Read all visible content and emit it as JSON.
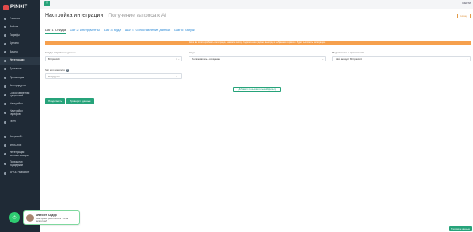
{
  "brand": {
    "logo_text": "PINKIT"
  },
  "sidebar": {
    "items": [
      {
        "label": "Главная"
      },
      {
        "label": "Войны"
      },
      {
        "label": "Тарифы"
      },
      {
        "label": "Купоны"
      },
      {
        "label": "Видео"
      },
      {
        "label": "Интеграции"
      },
      {
        "label": "Доставка"
      },
      {
        "label": "Промокоды"
      },
      {
        "label": "Акт.продукты"
      },
      {
        "label": "Сопоставления\nсущностей"
      },
      {
        "label": "Настройки"
      },
      {
        "label": "Настройки\nтарифов"
      },
      {
        "label": "Телл"
      }
    ],
    "bottom_items": [
      {
        "label": "Битрикс24"
      },
      {
        "label": "amoCRM"
      },
      {
        "label": "Интеграция\nавтоматизации"
      },
      {
        "label": "Помощник\nподдержки"
      },
      {
        "label": "API & Разработ"
      }
    ]
  },
  "topbar": {
    "add_label": "+",
    "user_label": "Выйти"
  },
  "page": {
    "title": "Настройка интеграции",
    "subtitle": "Получение запроса к AI",
    "back_label": "Назад"
  },
  "tabs": [
    {
      "label": "Шаг 1: Откуда"
    },
    {
      "label": "Шаг 2: Инструменты"
    },
    {
      "label": "Шаг 3: Куда"
    },
    {
      "label": "Шаг 4: Сопоставление данных"
    },
    {
      "label": "Шаг 5: Запуск"
    }
  ],
  "notice": "Если вы хотите добавить интеграцию, нажмите кнопку. Подключение сделает выборку в выбранном сервисе и будет выполнять интеграцию.",
  "form": {
    "source": {
      "label": "Откуда отправлены данные",
      "value": "Битрикс24"
    },
    "events": {
      "label": "Когда",
      "value": "Пользователь - создание"
    },
    "account": {
      "label": "Подключенные приложения",
      "value": "Мой аккаунт Битрикс24"
    },
    "entity": {
      "label": "Тип пользователя",
      "value": "Сотрудник"
    },
    "add_field_label": "Добавить пользовательский фильтр"
  },
  "actions": {
    "continue_label": "Продолжить",
    "check_label": "Проверить данные"
  },
  "chat": {
    "name": "Алексей Сидор",
    "message": "Мне нужно разобраться с этим вопросом?"
  },
  "docs_label": "Тестовые данные",
  "colors": {
    "accent": "#26a37a",
    "sidebar": "#1f2a36",
    "notice": "#f6a04d",
    "link": "#2e8bd6"
  }
}
